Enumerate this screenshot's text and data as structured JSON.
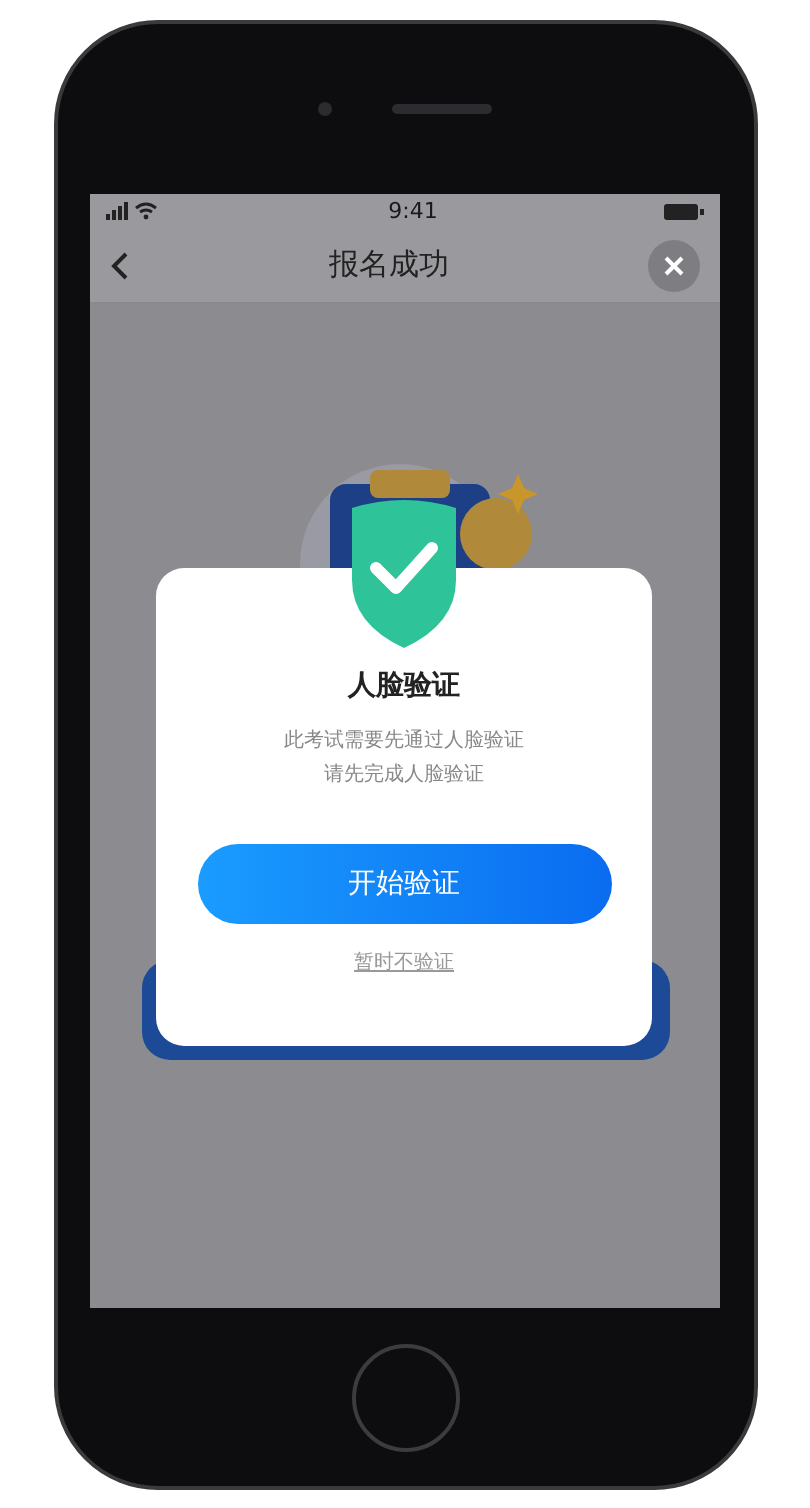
{
  "status_bar": {
    "time": "9:41"
  },
  "nav": {
    "title": "报名成功"
  },
  "dialog": {
    "title": "人脸验证",
    "message_lines": [
      "此考试需要先通过人脸验证",
      "请先完成人脸验证"
    ],
    "primary_button": "开始验证",
    "secondary_link": "暂时不验证"
  }
}
